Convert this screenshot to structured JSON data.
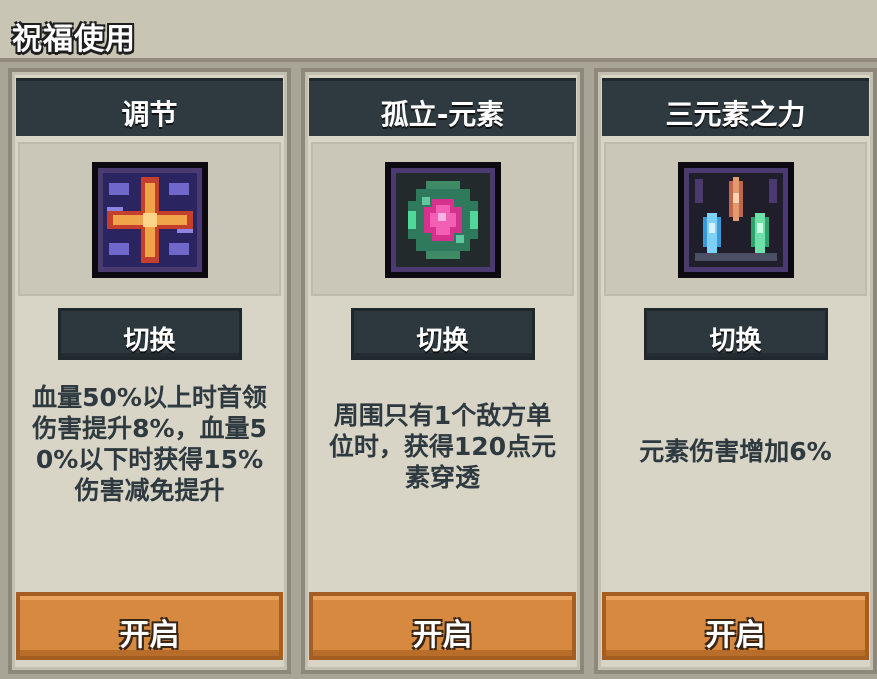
{
  "title": "祝福使用",
  "cards": [
    {
      "name": "调节",
      "icon": "orange-cross-rune-icon",
      "switch_label": "切换",
      "description": [
        "血量50%以上时首领",
        "伤害提升8%，血量5",
        "0%以下时获得15%",
        "伤害减免提升"
      ],
      "open_label": "开启"
    },
    {
      "name": "孤立-元素",
      "icon": "pink-green-gem-icon",
      "switch_label": "切换",
      "description": [
        "周围只有1个敌方单",
        "位时，获得120点元",
        "素穿透"
      ],
      "open_label": "开启"
    },
    {
      "name": "三元素之力",
      "icon": "three-element-crystals-icon",
      "switch_label": "切换",
      "description": [
        "元素伤害增加6%"
      ],
      "open_label": "开启"
    }
  ],
  "colors": {
    "background": "#a9a596",
    "card": "#d8d4c6",
    "header": "#2e3a40",
    "accent_orange": "#d6893f",
    "text_dark": "#2e3a40"
  }
}
